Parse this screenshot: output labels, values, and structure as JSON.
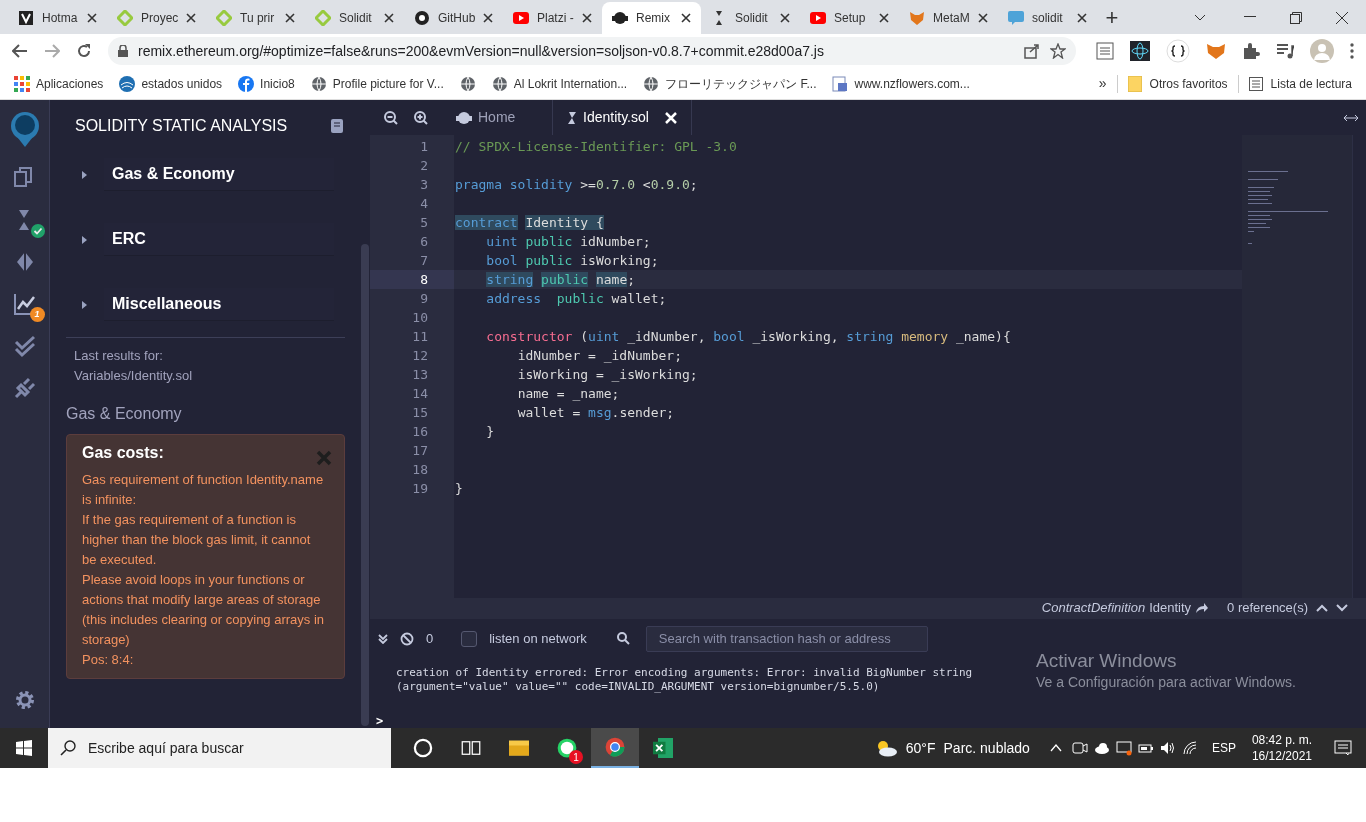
{
  "browser": {
    "tabs": [
      {
        "title": "Hotma",
        "kind": "page",
        "selected": false
      },
      {
        "title": "Proyec",
        "kind": "leaf",
        "selected": false
      },
      {
        "title": "Tu prir",
        "kind": "leaf",
        "selected": false
      },
      {
        "title": "Solidit",
        "kind": "leaf",
        "selected": false
      },
      {
        "title": "GitHub",
        "kind": "github",
        "selected": false
      },
      {
        "title": "Platzi -",
        "kind": "video",
        "selected": false
      },
      {
        "title": "Remix",
        "kind": "remix",
        "selected": true
      },
      {
        "title": "Solidit",
        "kind": "solidity",
        "selected": false
      },
      {
        "title": "Setup",
        "kind": "video",
        "selected": false
      },
      {
        "title": "MetaM",
        "kind": "fox",
        "selected": false
      },
      {
        "title": "solidit",
        "kind": "eth",
        "selected": false
      }
    ],
    "new_tab": "+",
    "url": "remix.ethereum.org/#optimize=false&runs=200&evmVersion=null&version=soljson-v0.8.7+commit.e28d00a7.js",
    "bookmarks": [
      {
        "label": "Aplicaciones",
        "kind": "grid"
      },
      {
        "label": "estados unidos",
        "kind": "swirl"
      },
      {
        "label": "Inicio8",
        "kind": "facebook"
      },
      {
        "label": "Profile picture for V...",
        "kind": "globe"
      },
      {
        "kind": "globe"
      },
      {
        "label": "Al Lokrit Internation...",
        "kind": "globe"
      },
      {
        "label": "フローリテックジャパン F...",
        "kind": "globe"
      },
      {
        "label": "www.nzflowers.com...",
        "kind": "doc"
      }
    ],
    "more": "»",
    "other_bookmarks": "Otros favoritos",
    "reading_list": "Lista de lectura"
  },
  "side_panel": {
    "title": "SOLIDITY STATIC ANALYSIS",
    "sections": [
      {
        "label": "Gas & Economy",
        "expanded": false
      },
      {
        "label": "ERC",
        "expanded": false
      },
      {
        "label": "Miscellaneous",
        "expanded": false
      }
    ],
    "last_results_label": "Last results for:",
    "last_results_file": "Variables/Identity.sol",
    "category": "Gas & Economy",
    "warning": {
      "title": "Gas costs:",
      "lines": [
        "Gas requirement of function Identity.name is infinite:",
        "If the gas requirement of a function is higher than the block gas limit, it cannot be executed.",
        "Please avoid loops in your functions or actions that modify large areas of storage (this includes clearing or copying arrays in storage)",
        "Pos: 8:4:"
      ]
    }
  },
  "icon_bar": [
    {
      "kind": "files",
      "ok": false,
      "selected": false
    },
    {
      "kind": "compiler",
      "ok": true,
      "selected": false
    },
    {
      "kind": "deploy",
      "ok": false,
      "selected": false
    },
    {
      "kind": "analysis",
      "badge": "1",
      "ok": false,
      "selected": true
    },
    {
      "kind": "tests",
      "ok": false,
      "selected": false
    },
    {
      "kind": "plugin",
      "ok": false,
      "selected": false
    }
  ],
  "editor": {
    "tabs": [
      {
        "label": "Home",
        "selected": false,
        "closable": false
      },
      {
        "label": "Identity.sol",
        "selected": true,
        "closable": true
      }
    ],
    "lines": [
      {
        "n": "1",
        "active": false,
        "tokens": [
          {
            "text": "// SPDX-License-Identifier: GPL -3.0",
            "kind": "comment",
            "marked": false
          }
        ]
      },
      {
        "n": "2",
        "active": false
      },
      {
        "n": "3",
        "active": false,
        "tokens": [
          {
            "text": "pragma solidity",
            "kind": "keyword",
            "marked": false
          },
          {
            "text": " >=",
            "kind": "plain",
            "marked": false
          },
          {
            "text": "0.7.0",
            "kind": "number",
            "marked": false
          },
          {
            "text": " <",
            "kind": "plain",
            "marked": false
          },
          {
            "text": "0.9.0",
            "kind": "number",
            "marked": false
          },
          {
            "text": ";",
            "kind": "plain",
            "marked": false
          }
        ]
      },
      {
        "n": "4",
        "active": false
      },
      {
        "n": "5",
        "active": false,
        "tokens": [
          {
            "text": "contract",
            "kind": "keyword",
            "marked": true
          },
          {
            "text": " Identity {",
            "kind": "plain",
            "marked": true
          }
        ]
      },
      {
        "n": "6",
        "active": false,
        "tokens": [
          {
            "text": "    uint",
            "kind": "type",
            "marked": false
          },
          {
            "text": " public",
            "kind": "modifier",
            "marked": false
          },
          {
            "text": " idNumber;",
            "kind": "plain",
            "marked": false
          }
        ]
      },
      {
        "n": "7",
        "active": false,
        "tokens": [
          {
            "text": "    bool",
            "kind": "type",
            "marked": false
          },
          {
            "text": " public",
            "kind": "modifier",
            "marked": false
          },
          {
            "text": " isWorking;",
            "kind": "plain",
            "marked": false
          }
        ]
      },
      {
        "n": "8",
        "active": true,
        "tokens": [
          {
            "text": "    string",
            "kind": "type",
            "marked": true
          },
          {
            "text": " public",
            "kind": "modifier",
            "marked": true
          },
          {
            "text": " name",
            "kind": "plain",
            "marked": true
          },
          {
            "text": ";",
            "kind": "plain",
            "marked": false
          }
        ]
      },
      {
        "n": "9",
        "active": false,
        "tokens": [
          {
            "text": "    address",
            "kind": "type",
            "marked": false
          },
          {
            "text": "  public",
            "kind": "modifier",
            "marked": false
          },
          {
            "text": " wallet;",
            "kind": "plain",
            "marked": false
          }
        ]
      },
      {
        "n": "10",
        "active": false
      },
      {
        "n": "11",
        "active": false,
        "tokens": [
          {
            "text": "    constructor",
            "kind": "ctor",
            "marked": false
          },
          {
            "text": " (",
            "kind": "plain",
            "marked": false
          },
          {
            "text": "uint",
            "kind": "type",
            "marked": false
          },
          {
            "text": " _idNumber, ",
            "kind": "plain",
            "marked": false
          },
          {
            "text": "bool",
            "kind": "type",
            "marked": false
          },
          {
            "text": " _isWorking, ",
            "kind": "plain",
            "marked": false
          },
          {
            "text": "string",
            "kind": "type",
            "marked": false
          },
          {
            "text": " memory",
            "kind": "storage",
            "marked": false
          },
          {
            "text": " _name){",
            "kind": "plain",
            "marked": false
          }
        ]
      },
      {
        "n": "12",
        "active": false,
        "tokens": [
          {
            "text": "        idNumber = _idNumber;",
            "kind": "plain",
            "marked": false
          }
        ]
      },
      {
        "n": "13",
        "active": false,
        "tokens": [
          {
            "text": "        isWorking = _isWorking;",
            "kind": "plain",
            "marked": false
          }
        ]
      },
      {
        "n": "14",
        "active": false,
        "tokens": [
          {
            "text": "        name = _name;",
            "kind": "plain",
            "marked": false
          }
        ]
      },
      {
        "n": "15",
        "active": false,
        "tokens": [
          {
            "text": "        wallet = ",
            "kind": "plain",
            "marked": false
          },
          {
            "text": "msg",
            "kind": "type",
            "marked": false
          },
          {
            "text": ".sender;",
            "kind": "plain",
            "marked": false
          }
        ]
      },
      {
        "n": "16",
        "active": false,
        "tokens": [
          {
            "text": "    }",
            "kind": "plain",
            "marked": false
          }
        ]
      },
      {
        "n": "17",
        "active": false
      },
      {
        "n": "18",
        "active": false
      },
      {
        "n": "19",
        "active": false,
        "tokens": [
          {
            "text": "}",
            "kind": "plain",
            "marked": false
          }
        ]
      }
    ],
    "reference_kind": "ContractDefinition",
    "reference_name": "Identity",
    "references": "0 reference(s)"
  },
  "terminal": {
    "count": "0",
    "listen_label": "listen on network",
    "listen_checked": false,
    "search_placeholder": "Search with transaction hash or address",
    "output": "creation of Identity errored: Error encoding arguments: Error: invalid BigNumber string (argument=\"value\" value=\"\" code=INVALID_ARGUMENT version=bignumber/5.5.0)",
    "prompt": ">"
  },
  "activation": {
    "title": "Activar Windows",
    "text": "Ve a Configuración para activar Windows."
  },
  "taskbar": {
    "search_placeholder": "Escribe aquí para buscar",
    "apps": [
      {
        "kind": "cortana",
        "selected": false
      },
      {
        "kind": "taskview",
        "selected": false
      },
      {
        "kind": "folder",
        "selected": false
      },
      {
        "kind": "whatsapp",
        "badge": "1",
        "selected": false
      },
      {
        "kind": "chrome",
        "selected": true
      },
      {
        "kind": "excel",
        "selected": false
      }
    ],
    "weather": "60°F",
    "weather_text": "Parc. nublado",
    "language": "ESP",
    "time": "08:42 p. m.",
    "date": "16/12/2021"
  }
}
